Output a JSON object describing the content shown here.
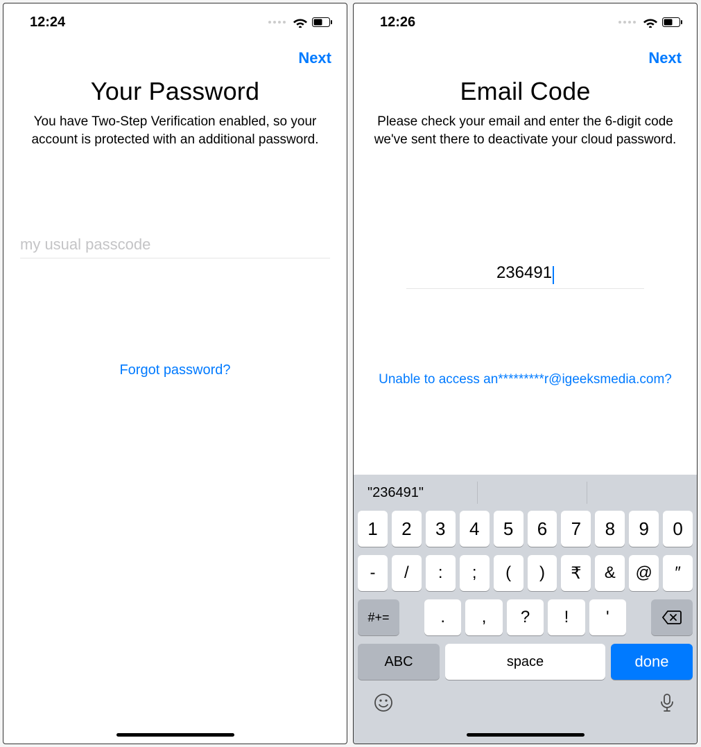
{
  "left": {
    "status": {
      "time": "12:24"
    },
    "nav": {
      "next": "Next"
    },
    "title": "Your Password",
    "subtitle": "You have Two-Step Verification enabled, so your account is protected with an additional password.",
    "password_placeholder": "my usual passcode",
    "forgot": "Forgot password?"
  },
  "right": {
    "status": {
      "time": "12:26"
    },
    "nav": {
      "next": "Next"
    },
    "title": "Email Code",
    "subtitle": "Please check your email and enter the 6-digit code we've sent there to deactivate your cloud password.",
    "code_value": "236491",
    "unable": "Unable to access an*********r@igeeksmedia.com?",
    "keyboard": {
      "suggestion": "\"236491\"",
      "row1": [
        "1",
        "2",
        "3",
        "4",
        "5",
        "6",
        "7",
        "8",
        "9",
        "0"
      ],
      "row2": [
        "-",
        "/",
        ":",
        ";",
        "(",
        ")",
        "₹",
        "&",
        "@",
        "″"
      ],
      "row3_fn": "#+=",
      "row3": [
        ".",
        ",",
        "?",
        "!",
        "'"
      ],
      "abc": "ABC",
      "space": "space",
      "done": "done"
    }
  }
}
